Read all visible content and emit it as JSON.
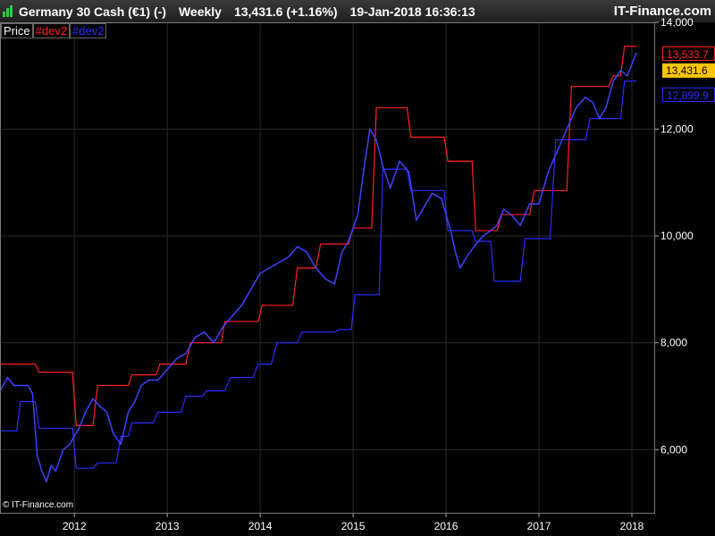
{
  "header": {
    "instrument": "Germany 30 Cash (€1) (-)",
    "period": "Weekly",
    "price_change": "13,431.6 (+1.16%)",
    "datetime": "19-Jan-2018 16:36:13",
    "brand": "IT-Finance.com"
  },
  "legend": {
    "price": "Price",
    "red": "#dev2",
    "blue": "#dev2"
  },
  "copyright": "© IT-Finance.com",
  "tags": {
    "red": "13,533.7",
    "price": "13,431.6",
    "blue": "12,899.9"
  },
  "colors": {
    "background": "#000000",
    "red": "#ff2020",
    "blue": "#2b2bff",
    "price_tag": "#ffc400",
    "grid": "#2a2a2a"
  },
  "chart_data": {
    "type": "line",
    "title": "Germany 30 Cash (€1) (-) Weekly",
    "xlabel": "",
    "ylabel": "",
    "x_ticks": [
      "2012",
      "2013",
      "2014",
      "2015",
      "2016",
      "2017",
      "2018"
    ],
    "y_ticks": [
      "6,000",
      "8,000",
      "10,000",
      "12,000",
      "14,000"
    ],
    "y_tick_values": [
      6000,
      8000,
      10000,
      12000,
      14000
    ],
    "ylim": [
      4800,
      14000
    ],
    "xlim": [
      2011.2,
      2018.25
    ],
    "grid": true,
    "legend": "top-left",
    "series": [
      {
        "name": "#dev2",
        "color": "#ff2020",
        "x": [
          2011.2,
          2011.38,
          2011.42,
          2011.58,
          2011.62,
          2011.98,
          2012.02,
          2012.2,
          2012.25,
          2012.58,
          2012.62,
          2012.88,
          2012.92,
          2013.2,
          2013.25,
          2013.58,
          2013.62,
          2013.98,
          2014.02,
          2014.35,
          2014.4,
          2014.6,
          2014.65,
          2014.95,
          2015.0,
          2015.2,
          2015.25,
          2015.58,
          2015.62,
          2015.98,
          2016.02,
          2016.28,
          2016.32,
          2016.55,
          2016.6,
          2016.9,
          2016.95,
          2017.3,
          2017.35,
          2017.75,
          2017.8,
          2017.88,
          2017.92,
          2018.05
        ],
        "y": [
          7600,
          7600,
          7600,
          7600,
          7450,
          7450,
          6450,
          6450,
          7200,
          7200,
          7400,
          7400,
          7600,
          7600,
          8000,
          8000,
          8400,
          8400,
          8700,
          8700,
          9400,
          9400,
          9850,
          9850,
          10150,
          10150,
          12400,
          12400,
          11850,
          11850,
          11400,
          11400,
          10100,
          10100,
          10400,
          10400,
          10850,
          10850,
          12800,
          12800,
          13000,
          13000,
          13550,
          13550
        ]
      },
      {
        "name": "#dev2",
        "color": "#2b2bff",
        "x": [
          2011.2,
          2011.38,
          2011.42,
          2011.58,
          2011.62,
          2011.98,
          2012.02,
          2012.2,
          2012.25,
          2012.45,
          2012.5,
          2012.58,
          2012.62,
          2012.85,
          2012.9,
          2013.15,
          2013.2,
          2013.38,
          2013.42,
          2013.62,
          2013.68,
          2013.92,
          2013.98,
          2014.12,
          2014.18,
          2014.4,
          2014.45,
          2014.8,
          2014.85,
          2014.98,
          2015.02,
          2015.28,
          2015.32,
          2015.58,
          2015.62,
          2015.98,
          2016.02,
          2016.28,
          2016.32,
          2016.48,
          2016.52,
          2016.8,
          2016.85,
          2017.0,
          2017.05,
          2017.12,
          2017.18,
          2017.5,
          2017.55,
          2017.88,
          2017.92,
          2018.05
        ],
        "y": [
          6350,
          6350,
          6900,
          6900,
          6400,
          6400,
          5650,
          5650,
          5750,
          5750,
          6250,
          6250,
          6500,
          6500,
          6700,
          6700,
          7000,
          7000,
          7100,
          7100,
          7350,
          7350,
          7600,
          7600,
          8000,
          8000,
          8200,
          8200,
          8250,
          8250,
          8900,
          8900,
          11250,
          11250,
          10850,
          10850,
          10100,
          10100,
          9900,
          9900,
          9150,
          9150,
          9950,
          9950,
          9950,
          9950,
          11800,
          11800,
          12200,
          12200,
          12900,
          12900
        ]
      },
      {
        "name": "Price",
        "color": "#4040ff",
        "x": [
          2011.2,
          2011.28,
          2011.35,
          2011.45,
          2011.5,
          2011.55,
          2011.6,
          2011.65,
          2011.7,
          2011.75,
          2011.8,
          2011.88,
          2011.95,
          2012.05,
          2012.12,
          2012.2,
          2012.28,
          2012.35,
          2012.42,
          2012.5,
          2012.58,
          2012.65,
          2012.72,
          2012.8,
          2012.9,
          2013.0,
          2013.1,
          2013.2,
          2013.3,
          2013.4,
          2013.5,
          2013.6,
          2013.7,
          2013.8,
          2013.9,
          2014.0,
          2014.1,
          2014.2,
          2014.3,
          2014.4,
          2014.5,
          2014.6,
          2014.7,
          2014.8,
          2014.88,
          2014.95,
          2015.05,
          2015.12,
          2015.18,
          2015.25,
          2015.32,
          2015.4,
          2015.5,
          2015.6,
          2015.68,
          2015.75,
          2015.85,
          2015.95,
          2016.05,
          2016.1,
          2016.15,
          2016.22,
          2016.3,
          2016.4,
          2016.48,
          2016.55,
          2016.62,
          2016.7,
          2016.8,
          2016.9,
          2017.0,
          2017.1,
          2017.2,
          2017.3,
          2017.4,
          2017.5,
          2017.58,
          2017.65,
          2017.72,
          2017.8,
          2017.88,
          2017.95,
          2018.05
        ],
        "y": [
          7100,
          7350,
          7200,
          7200,
          7200,
          7050,
          5900,
          5600,
          5400,
          5700,
          5600,
          6000,
          6100,
          6400,
          6700,
          6950,
          6800,
          6700,
          6300,
          6100,
          6700,
          6900,
          7200,
          7300,
          7300,
          7500,
          7700,
          7800,
          8100,
          8200,
          8000,
          8300,
          8500,
          8700,
          9000,
          9300,
          9400,
          9500,
          9600,
          9800,
          9700,
          9400,
          9200,
          9100,
          9700,
          9900,
          10400,
          11300,
          12000,
          11800,
          11300,
          10900,
          11400,
          11200,
          10300,
          10500,
          10800,
          10700,
          10100,
          9700,
          9400,
          9600,
          9800,
          10000,
          10100,
          10200,
          10500,
          10400,
          10200,
          10600,
          10600,
          11200,
          11600,
          12000,
          12400,
          12600,
          12500,
          12200,
          12400,
          12900,
          13100,
          13000,
          13431.6
        ]
      }
    ]
  }
}
